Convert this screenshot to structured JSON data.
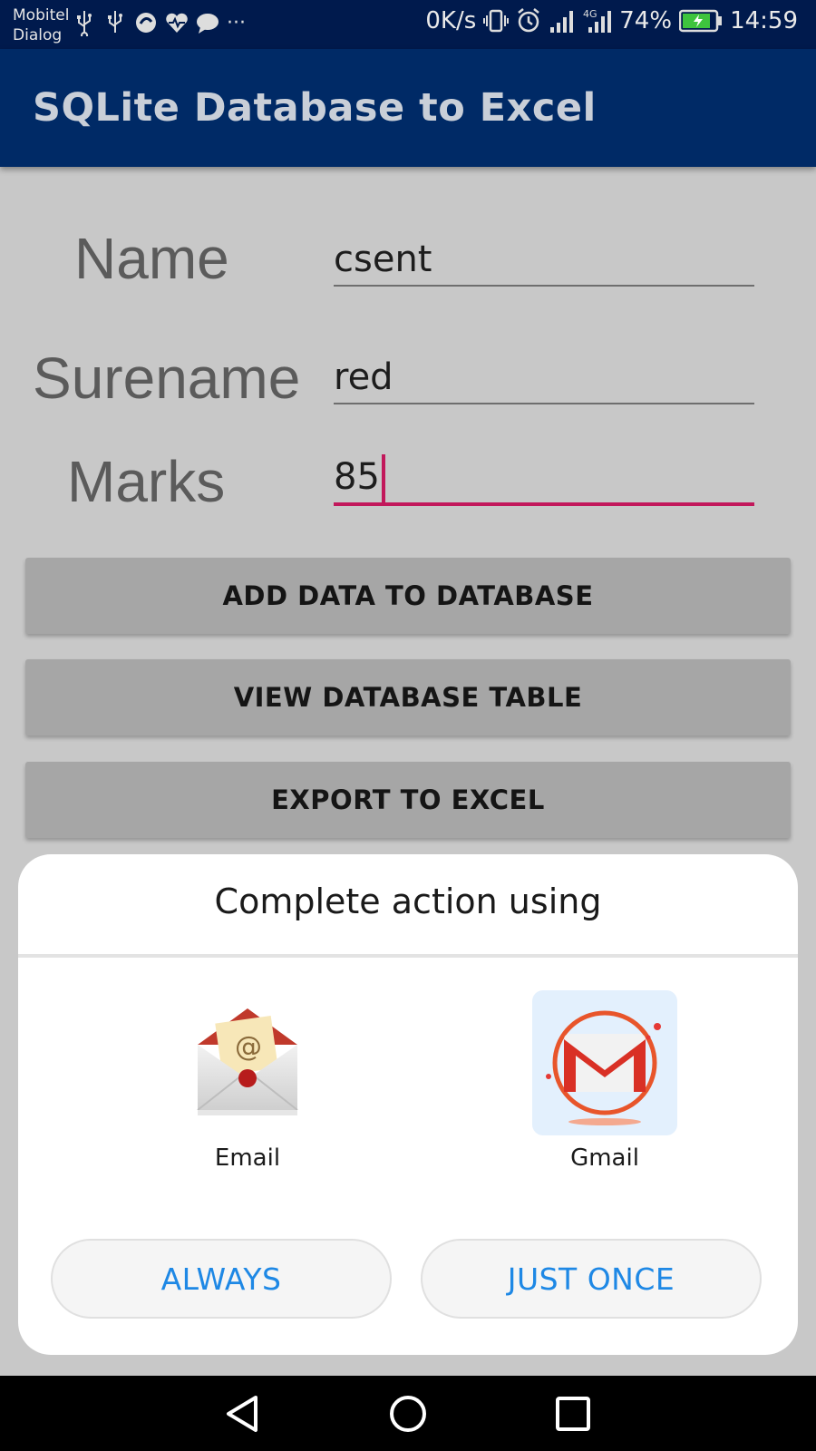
{
  "status_bar": {
    "carrier_line1": "Mobitel",
    "carrier_line2": "Dialog",
    "left_icons": [
      "usb-icon",
      "usb-icon",
      "sync-icon",
      "health-icon",
      "chat-icon"
    ],
    "overflow": "···",
    "net_speed": "0K/s",
    "battery_percent": "74%",
    "time": "14:59"
  },
  "app_bar": {
    "title": "SQLite Database to Excel"
  },
  "form": {
    "name_label": "Name",
    "name_value": "csent",
    "surename_label": "Surename",
    "surename_value": "red",
    "marks_label": "Marks",
    "marks_value": "85"
  },
  "buttons": {
    "add": "ADD DATA TO DATABASE",
    "view": "VIEW DATABASE TABLE",
    "export": "EXPORT TO EXCEL"
  },
  "chooser": {
    "title": "Complete action using",
    "apps": [
      {
        "label": "Email",
        "icon": "email-envelope-icon"
      },
      {
        "label": "Gmail",
        "icon": "gmail-icon"
      }
    ],
    "always_label": "ALWAYS",
    "just_once_label": "JUST ONCE"
  },
  "colors": {
    "app_bar": "#002a66",
    "status_bar": "#001a4d",
    "accent": "#c2185b",
    "dialog_action": "#1e88e5"
  }
}
